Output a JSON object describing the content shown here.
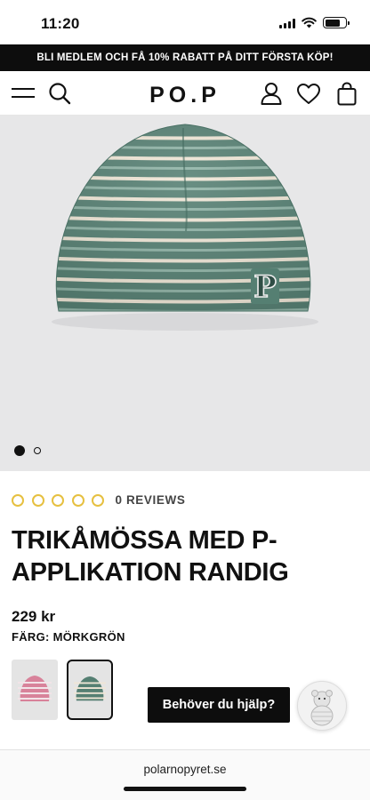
{
  "status_bar": {
    "time": "11:20"
  },
  "promo": {
    "text": "BLI MEDLEM OCH FÅ 10% RABATT PÅ DITT FÖRSTA KÖP!"
  },
  "header": {
    "logo": "PO.P"
  },
  "gallery": {
    "slide_count": 2,
    "active_slide": 1,
    "patch_letter": "P"
  },
  "product": {
    "rating_stars": 5,
    "reviews_label": "0 REVIEWS",
    "title": "TRIKÅMÖSSA MED P-APPLIKATION RANDIG",
    "price": "229 kr",
    "color_label": "FÄRG: MÖRKGRÖN",
    "swatches": [
      {
        "name": "pink-stripe",
        "color": "#d8829a"
      },
      {
        "name": "green-stripe",
        "color": "#4f7a6d",
        "selected": true
      }
    ]
  },
  "help": {
    "label": "Behöver du hjälp?"
  },
  "browser": {
    "url": "polarnopyret.se"
  },
  "colors": {
    "hat_green": "#557f72",
    "stripe_cream": "#efe6d6",
    "stripe_mint": "#8fb3a6",
    "star_outline": "#e6c040"
  }
}
